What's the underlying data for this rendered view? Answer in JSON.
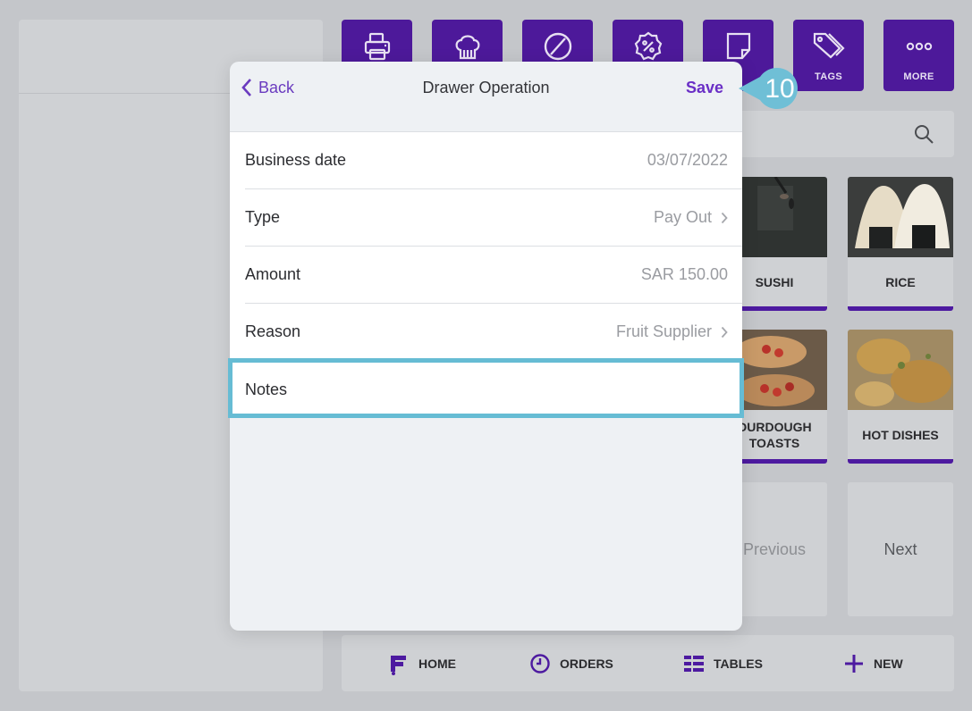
{
  "toolbar": {
    "buttons": [
      {
        "name": "print",
        "label": ""
      },
      {
        "name": "kitchen",
        "label": ""
      },
      {
        "name": "void",
        "label": ""
      },
      {
        "name": "discount",
        "label": ""
      },
      {
        "name": "notes",
        "label": ""
      },
      {
        "name": "tags",
        "label": "TAGS"
      },
      {
        "name": "more",
        "label": "MORE"
      }
    ]
  },
  "categories": [
    {
      "label": "SUSHI"
    },
    {
      "label": "RICE"
    },
    {
      "label": "OURDOUGH TOASTS"
    },
    {
      "label": "HOT DISHES"
    }
  ],
  "pager": {
    "previous": "Previous",
    "next": "Next"
  },
  "bottom_nav": {
    "home": "HOME",
    "orders": "ORDERS",
    "tables": "TABLES",
    "new": "NEW"
  },
  "modal": {
    "back_label": "Back",
    "title": "Drawer Operation",
    "save_label": "Save",
    "fields": {
      "business_date": {
        "label": "Business date",
        "value": "03/07/2022"
      },
      "type": {
        "label": "Type",
        "value": "Pay Out"
      },
      "amount": {
        "label": "Amount",
        "value": "SAR 150.00"
      },
      "reason": {
        "label": "Reason",
        "value": "Fruit Supplier"
      },
      "notes": {
        "label": "Notes",
        "value": ""
      }
    }
  },
  "step_badge": "10",
  "colors": {
    "accent": "#6a2fc6",
    "toolbar": "#4d199a",
    "highlight": "#66bcd4"
  }
}
